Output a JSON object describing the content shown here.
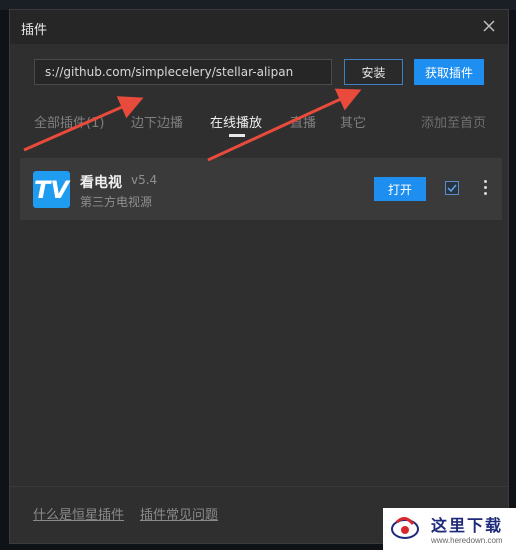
{
  "dialog": {
    "title": "插件",
    "close_icon": "close-icon"
  },
  "install": {
    "url_value": "s://github.com/simplecelery/stellar-alipan",
    "install_label": "安装",
    "get_plugins_label": "获取插件"
  },
  "tabs": [
    {
      "label": "全部插件(1)",
      "active": false
    },
    {
      "label": "边下边播",
      "active": false
    },
    {
      "label": "在线播放",
      "active": true
    },
    {
      "label": "直播",
      "active": false
    },
    {
      "label": "其它",
      "active": false
    }
  ],
  "add_to_home": "添加至首页",
  "plugin": {
    "icon_text": "TV",
    "name": "看电视",
    "version": "v5.4",
    "description": "第三方电视源",
    "open_label": "打开",
    "checked": true,
    "more_icon": "more-vertical-icon"
  },
  "footer": {
    "link1": "什么是恒星插件",
    "link2": "插件常见问题"
  },
  "watermark": {
    "text": "这里下载",
    "url": "www.heredown.com"
  },
  "colors": {
    "accent": "#1f8ef1",
    "arrow": "#e84b3c",
    "dialog_bg": "#2f2f2f",
    "card_bg": "#3a3a3a"
  }
}
